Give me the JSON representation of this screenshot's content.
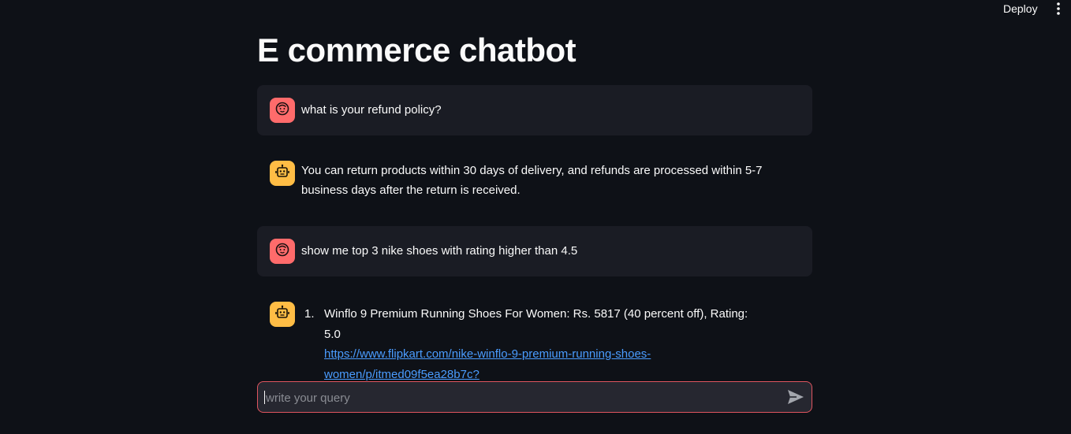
{
  "header": {
    "deploy_label": "Deploy",
    "menu_icon": "kebab-vertical-icon"
  },
  "page": {
    "title": "E commerce chatbot"
  },
  "messages": [
    {
      "role": "user",
      "avatar_icon": "smiley-face-icon",
      "text": "what is your refund policy?"
    },
    {
      "role": "assistant",
      "avatar_icon": "robot-icon",
      "text": "You can return products within 30 days of delivery, and refunds are processed within 5-7 business days after the return is received."
    },
    {
      "role": "user",
      "avatar_icon": "smiley-face-icon",
      "text": "show me top 3 nike shoes with rating higher than 4.5"
    },
    {
      "role": "assistant",
      "avatar_icon": "robot-icon",
      "list": [
        {
          "number": "1.",
          "text": "Winflo 9 Premium Running Shoes For Women: Rs. 5817 (40 percent off), Rating: 5.0",
          "link_line1": "https://www.flipkart.com/nike-winflo-9-premium-running-shoes-",
          "link_line2": "women/p/itmed09f5ea28b7c?"
        }
      ]
    }
  ],
  "chat_input": {
    "placeholder": "write your query",
    "value": "",
    "send_icon": "send-arrow-icon"
  },
  "colors": {
    "background": "#0e1117",
    "user_avatar": "#ff6b6b",
    "bot_avatar": "#ffbd45",
    "input_border": "#e0555f",
    "link": "#4a9cff"
  }
}
